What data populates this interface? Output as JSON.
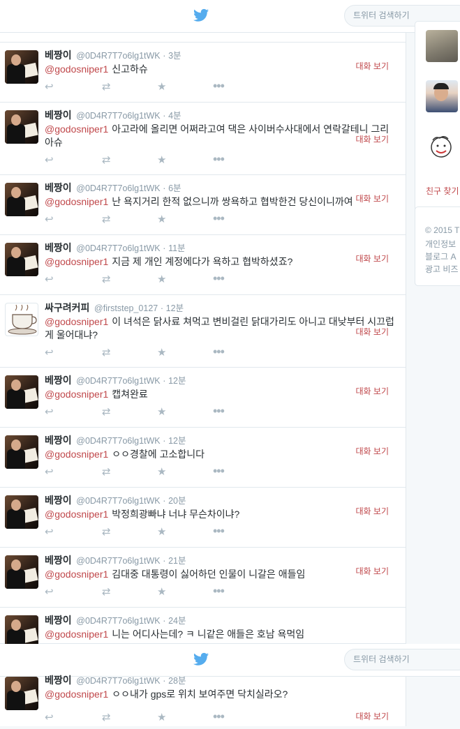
{
  "search": {
    "placeholder": "트위터 검색하기"
  },
  "tweets": [
    {
      "name": "베짱이",
      "handle": "@0D4R7T7o6lg1tWK",
      "time": "3분",
      "mention": "@godosniper1",
      "text": "신고하슈",
      "convo": "대화 보기",
      "avatar": "suit"
    },
    {
      "name": "베짱이",
      "handle": "@0D4R7T7o6lg1tWK",
      "time": "4분",
      "mention": "@godosniper1",
      "text": "아고라에 올리면 어쩌라고여 댁은 사이버수사대에서 연락갈테니 그리아슈",
      "convo": "대화 보기",
      "avatar": "suit"
    },
    {
      "name": "베짱이",
      "handle": "@0D4R7T7o6lg1tWK",
      "time": "6분",
      "mention": "@godosniper1",
      "text": "난 욕지거리 한적 없으니까 쌍욕하고 협박한건 당신이니까여",
      "convo": "대화 보기",
      "avatar": "suit"
    },
    {
      "name": "베짱이",
      "handle": "@0D4R7T7o6lg1tWK",
      "time": "11분",
      "mention": "@godosniper1",
      "text": "지금 제 개인 계정에다가 욕하고 협박하셨죠?",
      "convo": "대화 보기",
      "avatar": "suit"
    },
    {
      "name": "싸구려커피",
      "handle": "@firststep_0127",
      "time": "12분",
      "mention": "@godosniper1",
      "text": "이 녀석은 닭사료 쳐먹고 변비걸린 닭대가리도 아니고  대낮부터 시끄럽게  울어대냐?",
      "convo": "대화 보기",
      "avatar": "coffee"
    },
    {
      "name": "베짱이",
      "handle": "@0D4R7T7o6lg1tWK",
      "time": "12분",
      "mention": "@godosniper1",
      "text": "캡쳐완료",
      "convo": "대화 보기",
      "avatar": "suit"
    },
    {
      "name": "베짱이",
      "handle": "@0D4R7T7o6lg1tWK",
      "time": "12분",
      "mention": "@godosniper1",
      "text": "ㅇㅇ경찰에 고소합니다",
      "convo": "대화 보기",
      "avatar": "suit"
    },
    {
      "name": "베짱이",
      "handle": "@0D4R7T7o6lg1tWK",
      "time": "20분",
      "mention": "@godosniper1",
      "text": "박정희광빠냐 너냐 무슨차이냐?",
      "convo": "대화 보기",
      "avatar": "suit"
    },
    {
      "name": "베짱이",
      "handle": "@0D4R7T7o6lg1tWK",
      "time": "21분",
      "mention": "@godosniper1",
      "text": "김대중 대통령이  싫어하던 인물이 니갈은 애들임",
      "convo": "대화 보기",
      "avatar": "suit"
    },
    {
      "name": "베짱이",
      "handle": "@0D4R7T7o6lg1tWK",
      "time": "24분",
      "mention": "@godosniper1",
      "text": "니는 어디사는데? ㅋ 니같은 애들은 호남 욕먹임",
      "convo": "",
      "avatar": "suit"
    }
  ],
  "last_tweet": {
    "name": "베짱이",
    "handle": "@0D4R7T7o6lg1tWK",
    "time": "28분",
    "mention": "@godosniper1",
    "text": "ㅇㅇ내가 gps로 위치 보여주면 닥치실라오?",
    "convo": "대화 보기"
  },
  "sidebar": {
    "follow_link": "친구 찾기",
    "footer": [
      "© 2015 T",
      "개인정보",
      "블로그  A",
      "광고  비즈"
    ]
  },
  "colors": {
    "accent": "#c0484b",
    "twitter_blue": "#55acee"
  }
}
